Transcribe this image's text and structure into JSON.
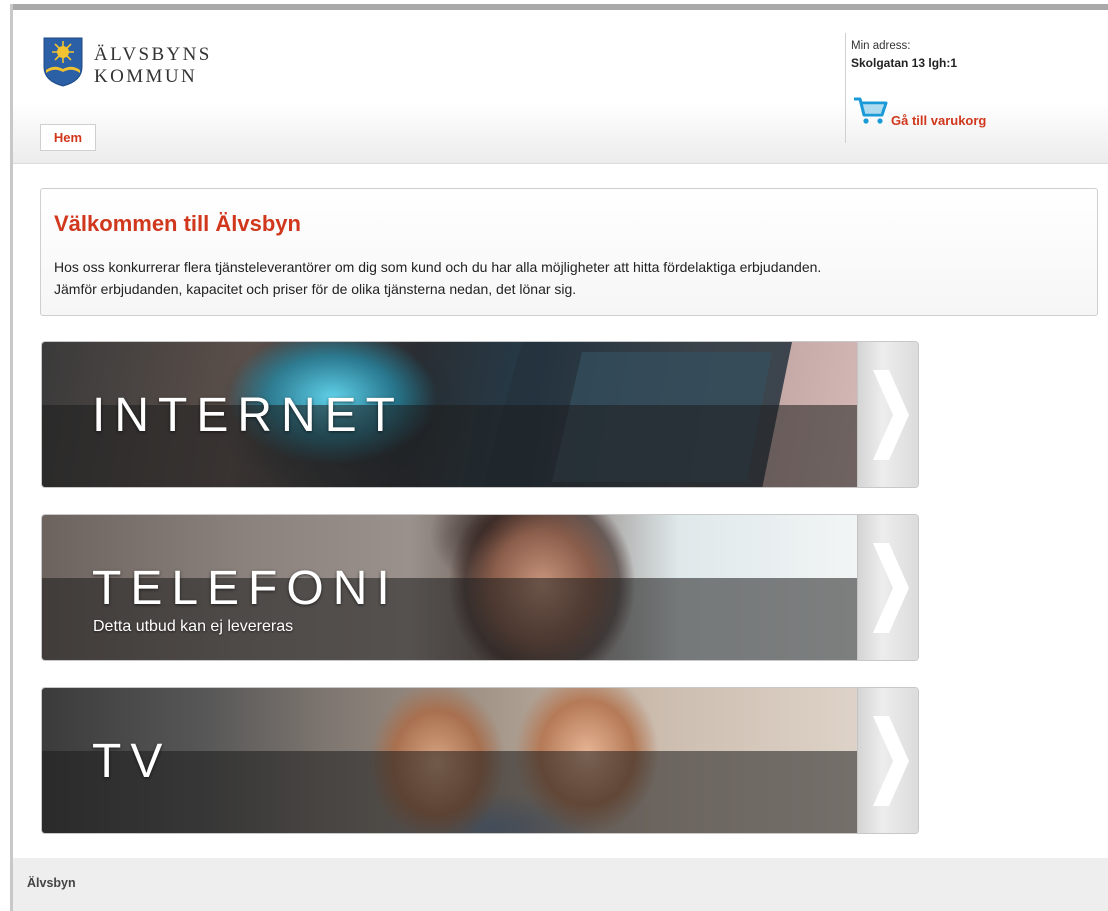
{
  "header": {
    "logo_line1": "ÄLVSBYNS",
    "logo_line2": "KOMMUN",
    "nav_home": "Hem",
    "address_label": "Min adress:",
    "address_value": "Skolgatan 13 lgh:1",
    "cart_link": "Gå till varukorg",
    "cart_icon": "cart-icon",
    "crest_icon": "municipality-crest-icon"
  },
  "welcome": {
    "title": "Välkommen till Älvsbyn",
    "line1": "Hos oss konkurrerar flera tjänsteleverantörer om dig som kund och du har alla möjligheter att hitta fördelaktiga erbjudanden.",
    "line2": "Jämför erbjudanden, kapacitet och priser för de olika tjänsterna nedan, det lönar sig."
  },
  "services": [
    {
      "title": "INTERNET",
      "subtitle": ""
    },
    {
      "title": "TELEFONI",
      "subtitle": "Detta utbud kan ej levereras"
    },
    {
      "title": "TV",
      "subtitle": ""
    }
  ],
  "footer": {
    "text": "Älvsbyn"
  },
  "colors": {
    "accent": "#d0371c",
    "cart": "#1a9bd7"
  }
}
